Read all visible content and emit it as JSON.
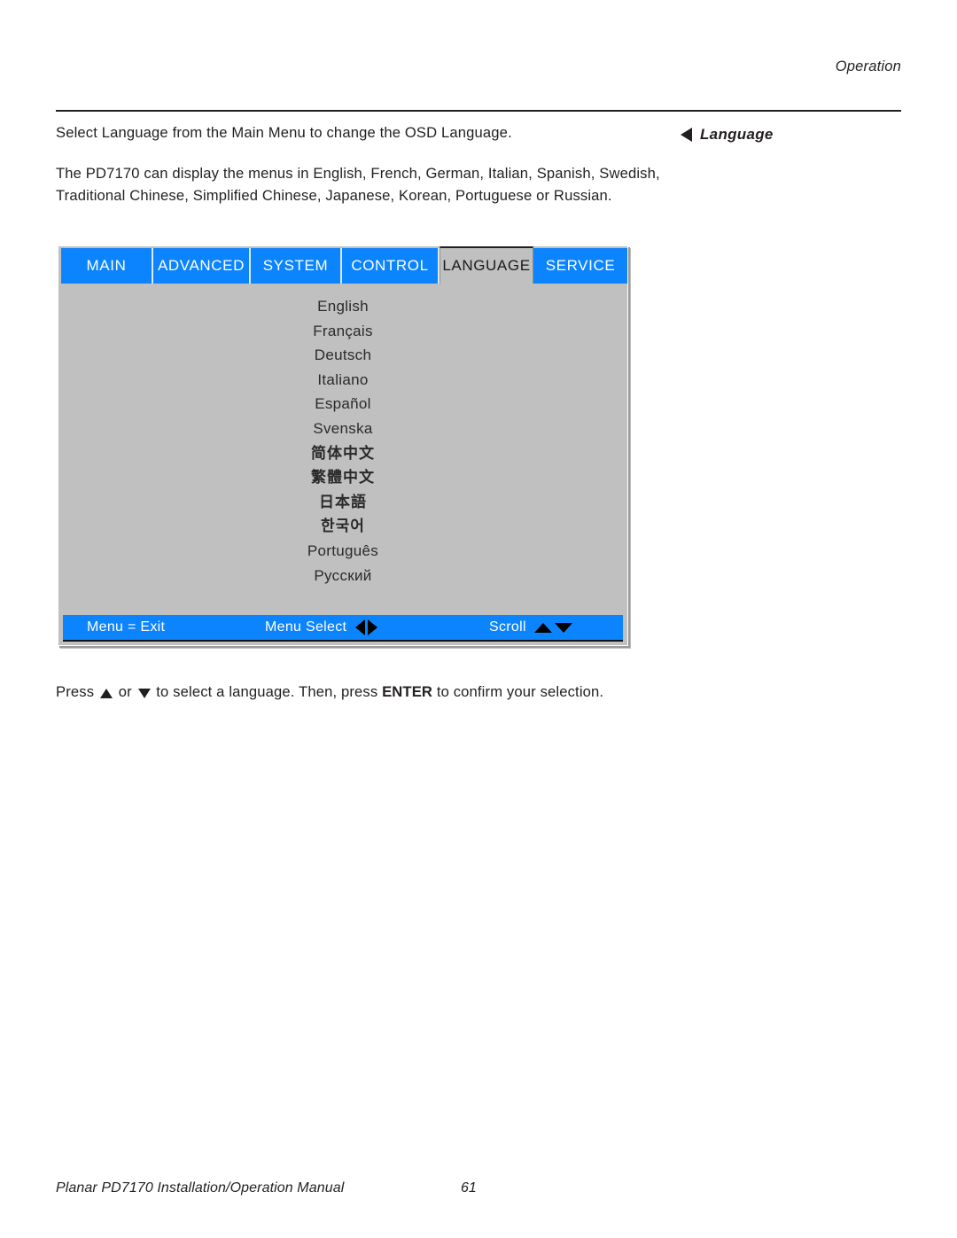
{
  "page": {
    "running_head": "Operation",
    "footer_title": "Planar PD7170 Installation/Operation Manual",
    "page_number": "61"
  },
  "margin_note": {
    "label": "Language",
    "marker_icon": "triangle-left-icon"
  },
  "body": {
    "paragraph_1": "Select Language from the Main Menu to change the OSD Language.",
    "paragraph_2": "The PD7170 can display the menus in English, French, German, Italian, Spanish, Swedish, Traditional Chinese, Simplified Chinese, Japanese, Korean, Portuguese or Russian."
  },
  "instruction": {
    "prefix": "Press ",
    "mid": " or ",
    "after_arrows": " to select a language. Then, press ",
    "key": "ENTER",
    "suffix": " to confirm your selection.",
    "up_icon": "triangle-up-icon",
    "down_icon": "triangle-down-icon"
  },
  "osd": {
    "tabs": [
      {
        "label": "MAIN",
        "active": false
      },
      {
        "label": "ADVANCED",
        "active": false
      },
      {
        "label": "SYSTEM",
        "active": false
      },
      {
        "label": "CONTROL",
        "active": false
      },
      {
        "label": "LANGUAGE",
        "active": true
      },
      {
        "label": "SERVICE",
        "active": false
      }
    ],
    "languages": [
      "English",
      "Français",
      "Deutsch",
      "Italiano",
      "Español",
      "Svenska",
      "简体中文",
      "繁體中文",
      "日本語",
      "한국어",
      "Português",
      "Русский"
    ],
    "status_bar": {
      "exit": "Menu = Exit",
      "menu_select": "Menu Select",
      "scroll": "Scroll",
      "left_icon": "triangle-left-icon",
      "right_icon": "triangle-right-icon",
      "up_icon": "triangle-up-icon",
      "down_icon": "triangle-down-icon"
    },
    "colors": {
      "tab_blue": "#0b84fd",
      "panel_gray": "#c0c0c0",
      "active_tab_text": "#1a1a1a"
    }
  }
}
